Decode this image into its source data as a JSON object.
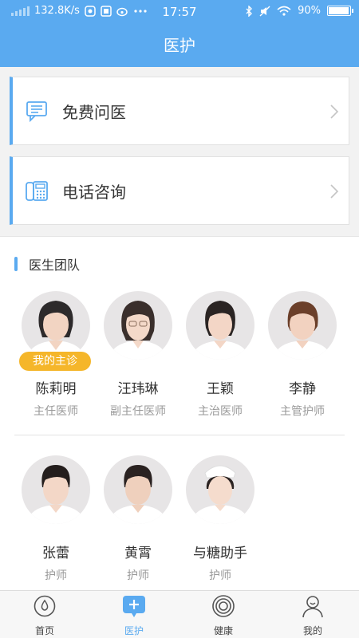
{
  "status_bar": {
    "network_speed": "132.8K/s",
    "time": "17:57",
    "battery": "90%",
    "battery_level": 0.9
  },
  "header": {
    "title": "医护"
  },
  "cards": [
    {
      "label": "免费问医",
      "icon": "chat-bubble-icon"
    },
    {
      "label": "电话咨询",
      "icon": "telephone-icon"
    }
  ],
  "team": {
    "title": "医生团队",
    "members": [
      {
        "name": "陈莉明",
        "role": "主任医师",
        "badge": "我的主诊"
      },
      {
        "name": "汪玮琳",
        "role": "副主任医师"
      },
      {
        "name": "王颖",
        "role": "主治医师"
      },
      {
        "name": "李静",
        "role": "主管护师"
      },
      {
        "name": "张蕾",
        "role": "护师"
      },
      {
        "name": "黄霄",
        "role": "护师"
      },
      {
        "name": "与糖助手",
        "role": "护师"
      }
    ]
  },
  "tabbar": {
    "items": [
      {
        "label": "首页",
        "icon": "home-drop-icon"
      },
      {
        "label": "医护",
        "icon": "plus-chat-icon"
      },
      {
        "label": "健康",
        "icon": "health-ring-icon"
      },
      {
        "label": "我的",
        "icon": "person-icon"
      }
    ],
    "active": "医护"
  },
  "colors": {
    "accent": "#5aaaf0",
    "badge": "#f5b62a"
  }
}
